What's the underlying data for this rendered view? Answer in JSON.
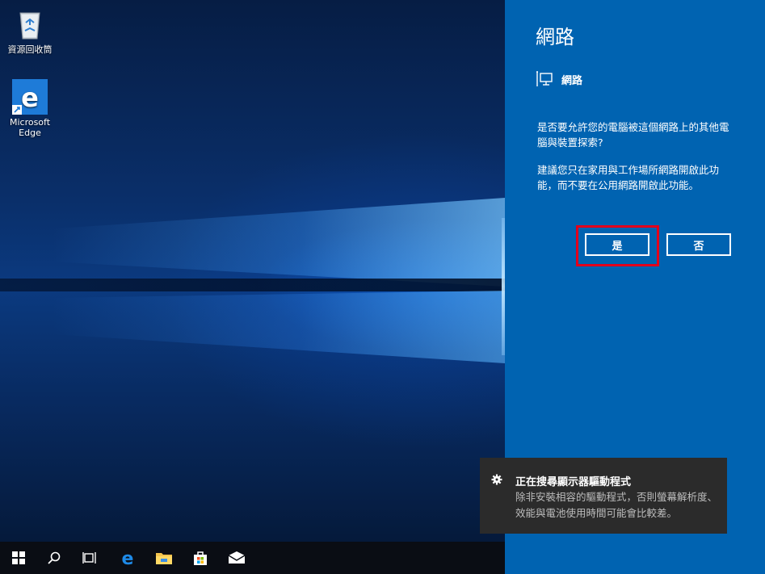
{
  "desktop": {
    "icons": [
      {
        "label": "資源回收筒",
        "icon": "recycle-bin-icon"
      },
      {
        "label": "Microsoft Edge",
        "icon": "edge-icon"
      }
    ]
  },
  "taskbar": {
    "items": [
      "start-icon",
      "search-icon",
      "task-view-icon",
      "edge-icon",
      "file-explorer-icon",
      "store-icon",
      "mail-icon"
    ]
  },
  "network_panel": {
    "title": "網路",
    "network_name": "網路",
    "question": "是否要允許您的電腦被這個網路上的其他電腦與裝置探索?",
    "advice": "建議您只在家用與工作場所網路開啟此功能，而不要在公用網路開啟此功能。",
    "yes_label": "是",
    "no_label": "否",
    "colors": {
      "panel_bg": "#0063b1",
      "highlight": "#e3001b"
    }
  },
  "notification": {
    "title": "正在搜尋顯示器驅動程式",
    "body": "除非安裝相容的驅動程式，否則螢幕解析度、效能與電池使用時間可能會比較差。",
    "icon": "gear-icon"
  }
}
